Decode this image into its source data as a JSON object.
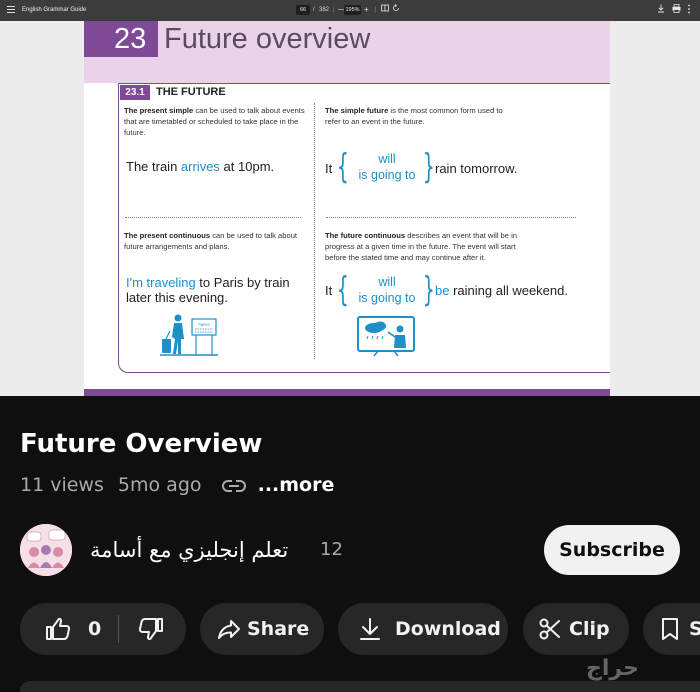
{
  "pdf_viewer": {
    "document_title": "English Grammar Guide",
    "page_current": "66",
    "page_separator": "/",
    "page_total": "382",
    "zoom": "195%",
    "zoom_out": "—",
    "zoom_in": "+"
  },
  "book": {
    "chapter_number": "23",
    "chapter_title": "Future overview",
    "section_number": "23.1",
    "section_title": "THE FUTURE",
    "quadrants": {
      "top_left": {
        "desc_bold": "The present simple",
        "desc_rest": " can be used to talk about events that are timetabled or scheduled to take place in the future.",
        "ex_pre": "The train ",
        "ex_blue": "arrives",
        "ex_post": " at 10pm."
      },
      "top_right": {
        "desc_bold": "The simple future",
        "desc_rest": " is the most common form used to refer to an event in the future.",
        "ex_pre": "It",
        "opt1": "will",
        "opt2": "is going to",
        "ex_post": "rain tomorrow."
      },
      "bottom_left": {
        "desc_bold": "The present continuous",
        "desc_rest": " can be used to talk about future arrangements and plans.",
        "ex_blue": "I'm traveling",
        "ex_post": " to Paris by train later this evening."
      },
      "bottom_right": {
        "desc_bold": "The future continuous",
        "desc_rest": " describes an event that will be in progress at a given time in the future. The event will start before the stated time and may continue after it.",
        "ex_pre": "It",
        "opt1": "will",
        "opt2": "is going to",
        "ex_blue": "be",
        "ex_post": " raining all weekend."
      }
    },
    "sign_text": "PARIS"
  },
  "video": {
    "title": "Future Overview",
    "views": "11 views",
    "age": "5mo ago",
    "more": "...more"
  },
  "channel": {
    "name": "تعلم إنجليزي مع أسامة",
    "subscriber_count": "12",
    "subscribe_label": "Subscribe"
  },
  "actions": {
    "like_count": "0",
    "share_label": "Share",
    "download_label": "Download",
    "clip_label": "Clip",
    "save_label": "S"
  },
  "watermark": "حراج",
  "colors": {
    "chapter_purple": "#7e4a96",
    "header_pink": "#ead3e9",
    "example_blue": "#1e8fc8",
    "youtube_bg": "#0f0f0f",
    "pill_bg": "#272727"
  }
}
